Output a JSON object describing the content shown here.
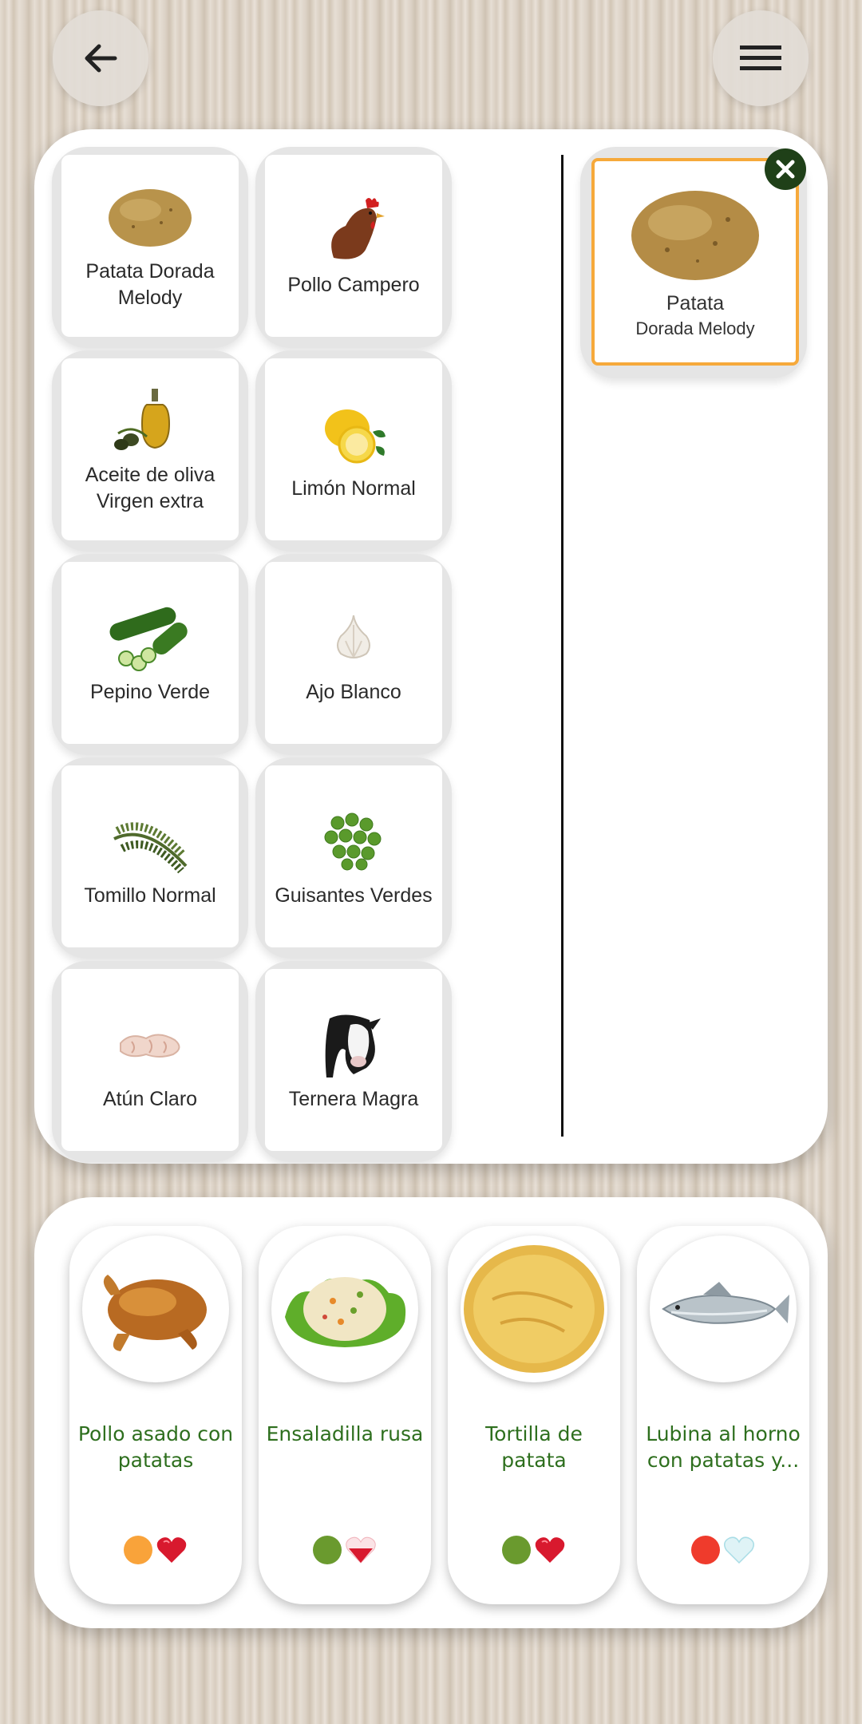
{
  "header": {
    "back_icon": "arrow-left-icon",
    "menu_icon": "hamburger-menu-icon"
  },
  "ingredients": [
    {
      "label": "Patata Dorada Melody",
      "icon": "potato-icon"
    },
    {
      "label": "Pollo Campero",
      "icon": "chicken-icon"
    },
    {
      "label": "Aceite de oliva Virgen extra",
      "icon": "olive-oil-icon"
    },
    {
      "label": "Limón Normal",
      "icon": "lemon-icon"
    },
    {
      "label": "Pepino Verde",
      "icon": "cucumber-icon"
    },
    {
      "label": "Ajo Blanco",
      "icon": "garlic-icon"
    },
    {
      "label": "Tomillo Normal",
      "icon": "thyme-icon"
    },
    {
      "label": "Guisantes Verdes",
      "icon": "peas-icon"
    },
    {
      "label": "Atún Claro",
      "icon": "tuna-icon"
    },
    {
      "label": "Ternera Magra",
      "icon": "cow-icon"
    }
  ],
  "selected": {
    "title": "Patata",
    "subtitle": "Dorada Melody",
    "icon": "potato-icon",
    "border_color": "#f6a93b",
    "remove_icon": "close-icon"
  },
  "recipes": [
    {
      "name": "Pollo asado con patatas",
      "dot_color": "#f9a33a",
      "heart": "heart-red-icon"
    },
    {
      "name": "Ensaladilla rusa",
      "dot_color": "#6a9a2e",
      "heart": "heart-half-red-icon"
    },
    {
      "name": "Tortilla de patata",
      "dot_color": "#6a9a2e",
      "heart": "heart-red-icon"
    },
    {
      "name": "Lubina al horno con patatas y...",
      "dot_color": "#ef3b2c",
      "heart": "heart-light-icon"
    }
  ]
}
